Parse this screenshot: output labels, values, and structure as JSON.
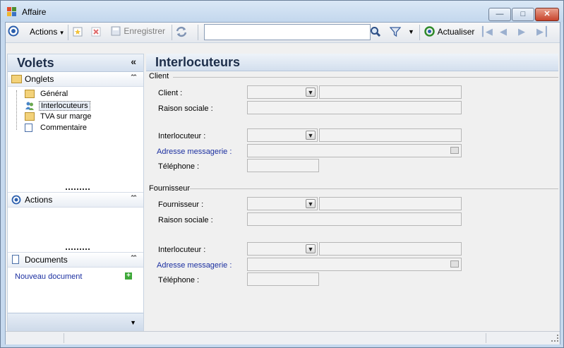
{
  "window": {
    "title": "Affaire",
    "colors": {
      "frame": "#c6d9ee",
      "accent": "#1d2e4a",
      "link": "#1b2fa0"
    }
  },
  "toolbar": {
    "actions_label": "Actions",
    "save_label": "Enregistrer",
    "refresh_label": "Actualiser",
    "search_value": "",
    "icons": [
      "nav-icon",
      "new-icon",
      "delete-icon",
      "save-icon",
      "sync-icon",
      "search-icon",
      "filter-icon",
      "refresh-icon",
      "first-icon",
      "prev-icon",
      "next-icon",
      "last-icon"
    ]
  },
  "left_pane": {
    "title": "Volets",
    "onglets": {
      "title": "Onglets",
      "items": [
        {
          "label": "Général",
          "icon": "folder-icon"
        },
        {
          "label": "Interlocuteurs",
          "icon": "contacts-icon",
          "selected": true
        },
        {
          "label": "TVA sur marge",
          "icon": "folder-icon"
        },
        {
          "label": "Commentaire",
          "icon": "document-icon"
        }
      ]
    },
    "actions": {
      "title": "Actions"
    },
    "documents": {
      "title": "Documents",
      "new_doc": "Nouveau document"
    }
  },
  "main": {
    "title": "Interlocuteurs",
    "client": {
      "group": "Client",
      "client_label": "Client :",
      "raison_label": "Raison sociale :",
      "interlocuteur_label": "Interlocuteur :",
      "email_label": "Adresse messagerie :",
      "phone_label": "Téléphone :"
    },
    "fournisseur": {
      "group": "Fournisseur",
      "fournisseur_label": "Fournisseur :",
      "raison_label": "Raison sociale :",
      "interlocuteur_label": "Interlocuteur :",
      "email_label": "Adresse messagerie :",
      "phone_label": "Téléphone :"
    }
  }
}
